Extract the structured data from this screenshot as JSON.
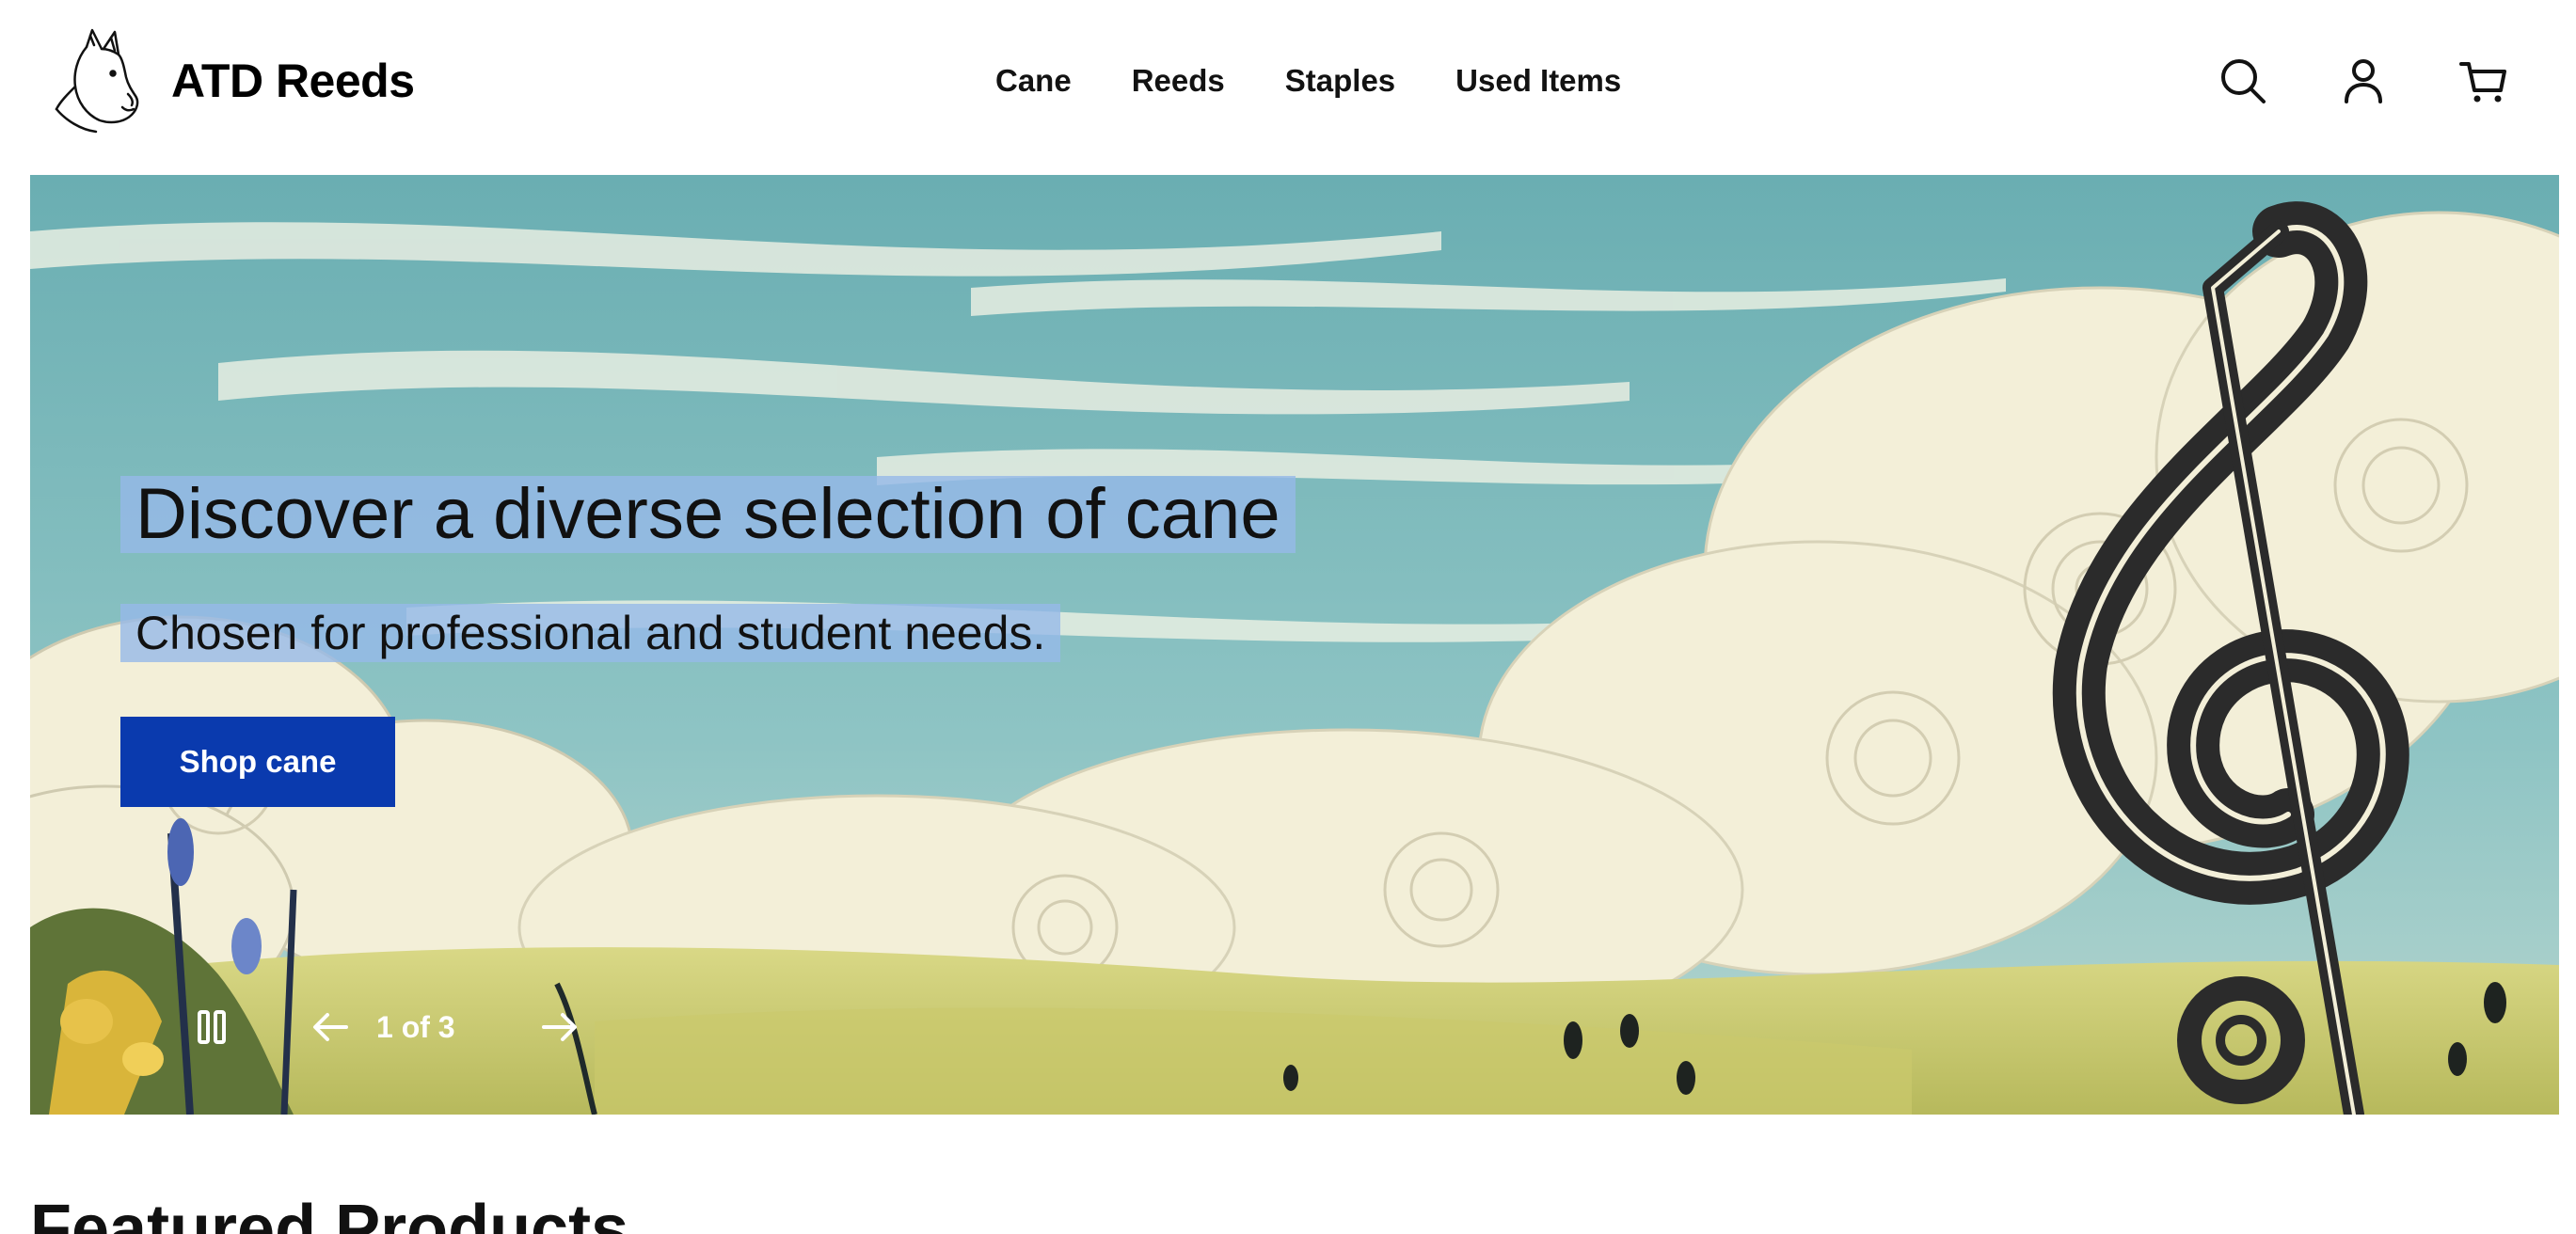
{
  "header": {
    "brand": "ATD Reeds",
    "nav": [
      "Cane",
      "Reeds",
      "Staples",
      "Used Items"
    ],
    "icons": [
      "dog-logo-icon",
      "search-icon",
      "account-icon",
      "cart-icon"
    ]
  },
  "hero": {
    "title": "Discover a diverse selection of cane",
    "subtitle": "Chosen for professional and student needs.",
    "button_label": "Shop cane",
    "slide_counter": "1 of 3",
    "current_slide": 1,
    "total_slides": 3,
    "colors": {
      "sky": "#66aeb3",
      "cloud": "#f3efd8",
      "meadow": "#c9cd6e",
      "button": "#0a3aae",
      "text_highlight": "#96b9e8"
    }
  },
  "featured": {
    "heading": "Featured Products"
  }
}
